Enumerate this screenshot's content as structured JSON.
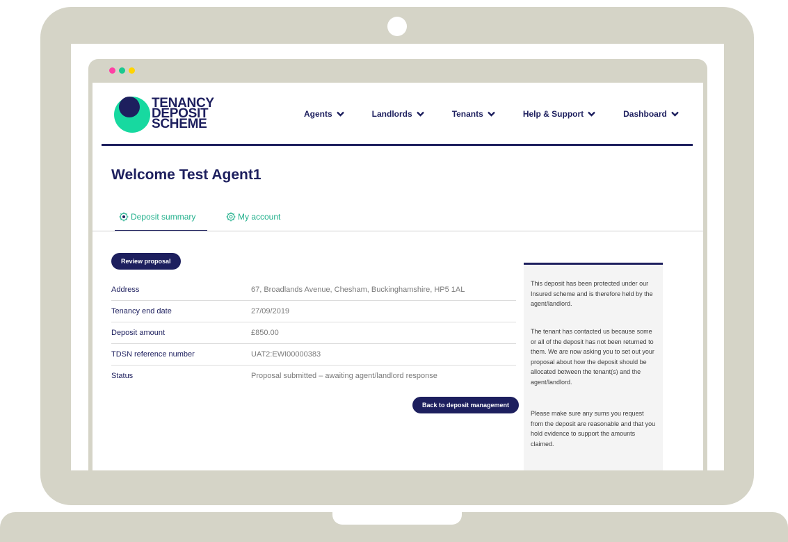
{
  "site": {
    "logo_lines": [
      "TENANCY",
      "DEPOSIT",
      "SCHEME"
    ],
    "nav": [
      "Agents",
      "Landlords",
      "Tenants",
      "Help & Support",
      "Dashboard"
    ]
  },
  "page": {
    "welcome": "Welcome Test Agent1",
    "tabs": [
      "Deposit summary",
      "My account"
    ],
    "review_button": "Review proposal",
    "back_button": "Back to deposit management"
  },
  "details": [
    {
      "label": "Address",
      "value": "67, Broadlands Avenue, Chesham, Buckinghamshire, HP5 1AL"
    },
    {
      "label": "Tenancy end date",
      "value": "27/09/2019"
    },
    {
      "label": "Deposit amount",
      "value": "£850.00"
    },
    {
      "label": "TDSN reference number",
      "value": "UAT2:EWI00000383"
    },
    {
      "label": "Status",
      "value": "Proposal submitted – awaiting agent/landlord response"
    }
  ],
  "side_panel": [
    "This deposit has been protected under our Insured scheme and is therefore held by the agent/landlord.",
    "The tenant has contacted us because some or all of the deposit has not been returned to them. We are now asking you to set out your proposal about how the deposit should be allocated between the tenant(s) and the agent/landlord.",
    "Please make sure any sums you request from the deposit are reasonable and that you hold evidence to support the amounts claimed."
  ],
  "colors": {
    "brand_navy": "#1d1f5e",
    "brand_green": "#22b08c",
    "logo_green": "#17d9a0",
    "dot_pink": "#ff3fa4",
    "dot_green": "#19c98f",
    "dot_yellow": "#ffd400",
    "frame": "#d5d4c7"
  }
}
